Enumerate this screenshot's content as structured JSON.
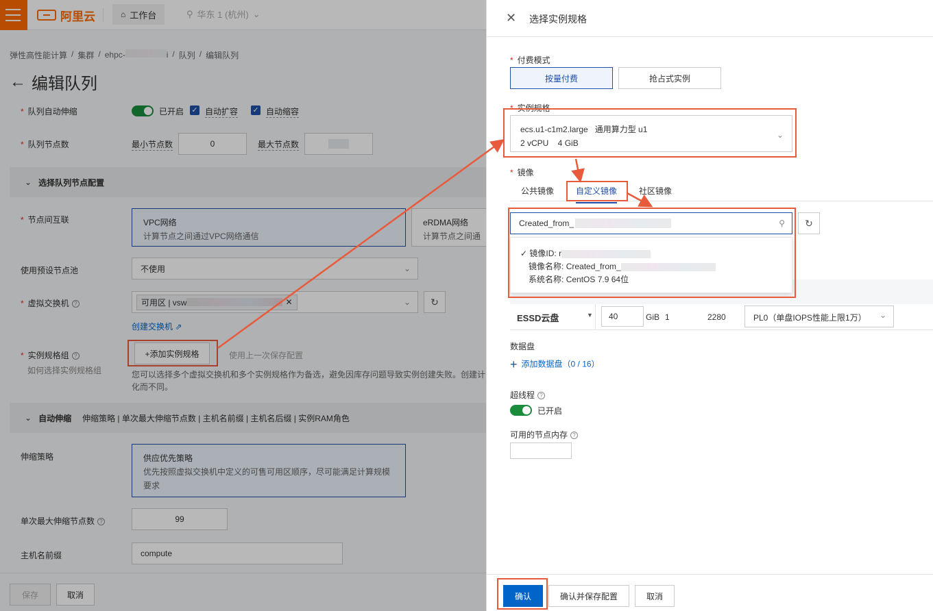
{
  "topbar": {
    "logo": "阿里云",
    "workbench": "工作台",
    "region": "华东 1 (杭州)"
  },
  "breadcrumb": [
    "弹性高性能计算",
    "集群",
    "ehpc-",
    "i",
    "队列",
    "编辑队列"
  ],
  "page_title": "编辑队列",
  "form": {
    "auto_scale_label": "队列自动伸缩",
    "auto_scale_status": "已开启",
    "auto_expand": "自动扩容",
    "auto_shrink": "自动缩容",
    "node_count_label": "队列节点数",
    "min_nodes_label": "最小节点数",
    "min_nodes_value": "0",
    "max_nodes_label": "最大节点数",
    "section_node_config": "选择队列节点配置",
    "interconnect_label": "节点间互联",
    "vpc_title": "VPC网络",
    "vpc_desc": "计算节点之间通过VPC网络通信",
    "erdma_title": "eRDMA网络",
    "erdma_desc": "计算节点之间通",
    "preset_pool_label": "使用预设节点池",
    "preset_pool_value": "不使用",
    "vswitch_label": "虚拟交换机",
    "vswitch_tag": "可用区 | vsw",
    "create_vswitch": "创建交换机",
    "spec_group_label": "实例规格组",
    "spec_group_help": "如何选择实例规格组",
    "add_spec_button": "+添加实例规格",
    "use_last_config": "使用上一次保存配置",
    "spec_hint_1": "您可以选择多个虚拟交换机和多个实例规格作为备选，避免因库存问题导致实例创建失败。创建计",
    "spec_hint_2": "化而不同。",
    "section_autoscale": "自动伸缩",
    "section_autoscale_tail": "伸缩策略 | 单次最大伸缩节点数 | 主机名前缀  | 主机名后缀  | 实例RAM角色",
    "policy_label": "伸缩策略",
    "policy_title": "供应优先策略",
    "policy_desc": "优先按照虚拟交换机中定义的可售可用区顺序，尽可能满足计算规模要求",
    "max_scale_label": "单次最大伸缩节点数",
    "max_scale_value": "99",
    "hostname_prefix_label": "主机名前缀",
    "hostname_prefix_value": "compute",
    "save": "保存",
    "cancel": "取消"
  },
  "drawer": {
    "title": "选择实例规格",
    "billing_label": "付费模式",
    "billing_options": [
      "按量付费",
      "抢占式实例"
    ],
    "spec_label": "实例规格",
    "spec_line1": "ecs.u1-c1m2.large   通用算力型 u1",
    "spec_line2": "2 vCPU    4 GiB",
    "image_label": "镜像",
    "image_tabs": [
      "公共镜像",
      "自定义镜像",
      "社区镜像"
    ],
    "search_value": "Created_from_",
    "dropdown": {
      "id_label": "镜像ID:",
      "id_prefix": "r",
      "name_label": "镜像名称:",
      "name_value": "Created_from_",
      "os_label": "系统名称:",
      "os_value": "CentOS 7.9 64位"
    },
    "disk": {
      "type": "ESSD云盘",
      "size": "40",
      "unit": "GiB",
      "col3": "1",
      "col4": "2280",
      "pl": "PL0（单盘IOPS性能上限1万）"
    },
    "data_disk_label": "数据盘",
    "add_data_disk": "添加数据盘（0 / 16）",
    "hyperthread_label": "超线程",
    "hyperthread_status": "已开启",
    "memory_label": "可用的节点内存",
    "confirm": "确认",
    "confirm_save": "确认并保存配置",
    "cancel": "取消"
  },
  "colors": {
    "accent": "#0064c8",
    "highlight": "#e85a3c",
    "brand": "#ff6a00"
  }
}
